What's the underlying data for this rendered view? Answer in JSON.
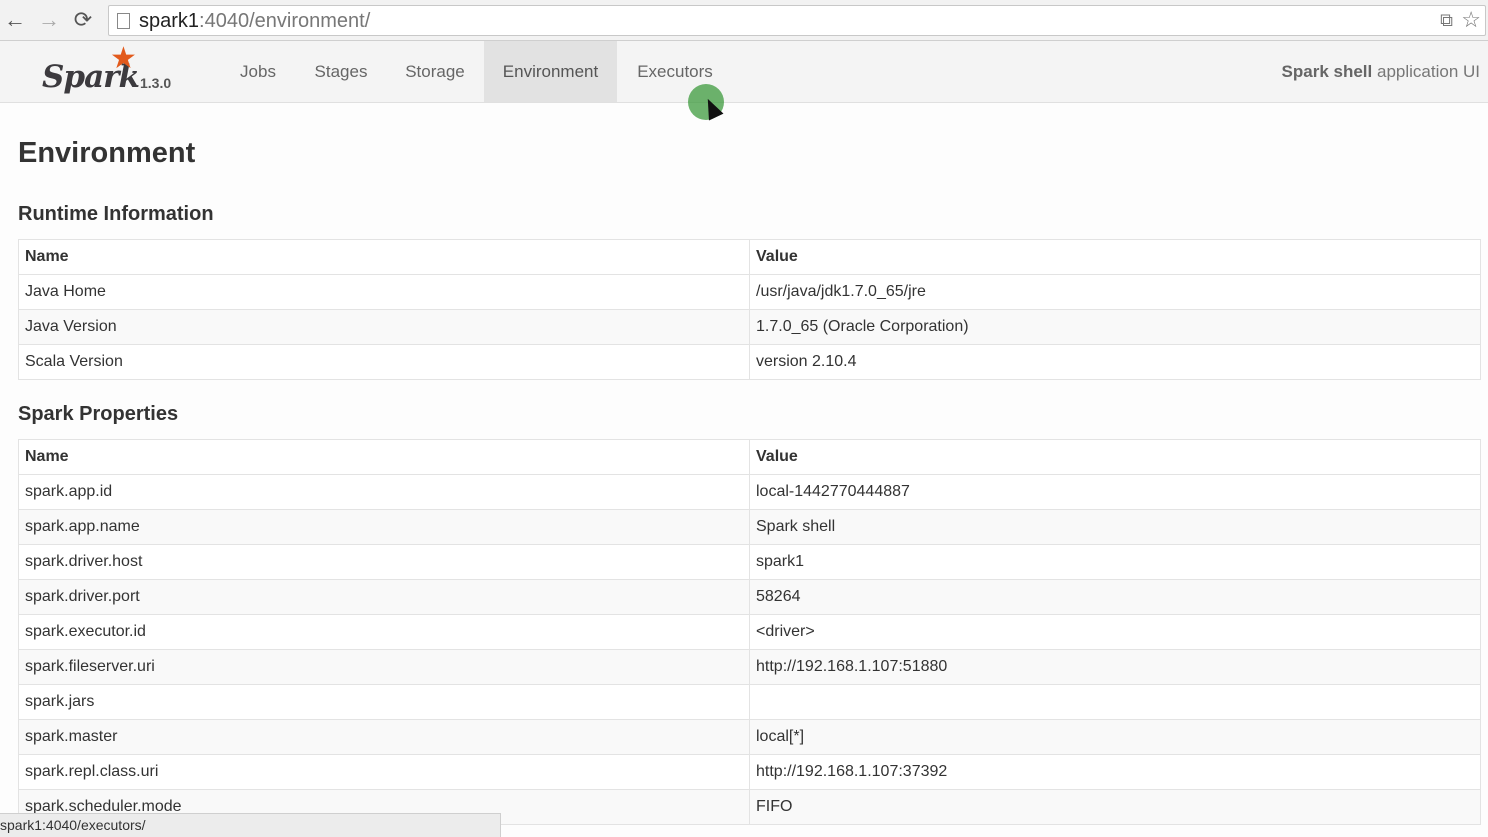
{
  "browser": {
    "url_host": "spark1",
    "url_path": ":4040/environment/",
    "back_icon": "←",
    "forward_icon": "→",
    "reload_icon": "⟳",
    "translate_icon": "⧉",
    "star_icon": "☆"
  },
  "navbar": {
    "brand": "Spark",
    "version": "1.3.0",
    "tabs": [
      {
        "label": "Jobs"
      },
      {
        "label": "Stages"
      },
      {
        "label": "Storage"
      },
      {
        "label": "Environment",
        "active": true
      },
      {
        "label": "Executors"
      }
    ],
    "app_name": "Spark shell",
    "app_suffix": " application UI"
  },
  "page": {
    "title": "Environment"
  },
  "runtime": {
    "heading": "Runtime Information",
    "headers": [
      "Name",
      "Value"
    ],
    "rows": [
      [
        "Java Home",
        "/usr/java/jdk1.7.0_65/jre"
      ],
      [
        "Java Version",
        "1.7.0_65 (Oracle Corporation)"
      ],
      [
        "Scala Version",
        "version 2.10.4"
      ]
    ]
  },
  "spark_properties": {
    "heading": "Spark Properties",
    "headers": [
      "Name",
      "Value"
    ],
    "rows": [
      [
        "spark.app.id",
        "local-1442770444887"
      ],
      [
        "spark.app.name",
        "Spark shell"
      ],
      [
        "spark.driver.host",
        "spark1"
      ],
      [
        "spark.driver.port",
        "58264"
      ],
      [
        "spark.executor.id",
        "<driver>"
      ],
      [
        "spark.fileserver.uri",
        "http://192.168.1.107:51880"
      ],
      [
        "spark.jars",
        ""
      ],
      [
        "spark.master",
        "local[*]"
      ],
      [
        "spark.repl.class.uri",
        "http://192.168.1.107:37392"
      ],
      [
        "spark.scheduler.mode",
        "FIFO"
      ]
    ]
  },
  "statusbar": {
    "text": "spark1:4040/executors/"
  }
}
